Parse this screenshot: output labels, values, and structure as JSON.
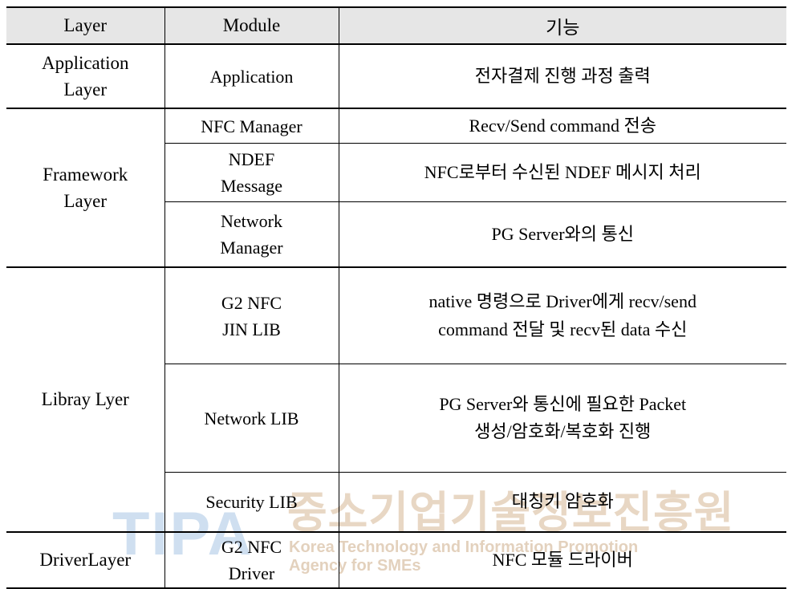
{
  "document": {
    "type": "spec-table",
    "title_visible": false
  },
  "watermark": {
    "logo_text": "TIPA",
    "korean_name": "중소기업기술정보진흥원",
    "english_line1": "Korea Technology and Information Promotion",
    "english_line2": "Agency for SMEs",
    "logo_color": "#cfdff0",
    "korean_color": "#e8d7c4",
    "english_color": "#e3d1bd"
  },
  "table": {
    "header_background": "#e6e6e6",
    "border_color": "#000000",
    "columns": [
      {
        "key": "layer",
        "label": "Layer"
      },
      {
        "key": "module",
        "label": "Module"
      },
      {
        "key": "func",
        "label": "기능"
      }
    ],
    "groups": [
      {
        "layer_lines": [
          "Application",
          "Layer"
        ],
        "rows": [
          {
            "module_lines": [
              "Application"
            ],
            "func_lines": [
              "전자결제 진행 과정 출력"
            ]
          }
        ]
      },
      {
        "layer_lines": [
          "Framework",
          "Layer"
        ],
        "rows": [
          {
            "module_lines": [
              "NFC Manager"
            ],
            "func_lines": [
              "Recv/Send command 전송"
            ]
          },
          {
            "module_lines": [
              "NDEF",
              "Message"
            ],
            "func_lines": [
              "NFC로부터 수신된 NDEF 메시지 처리"
            ]
          },
          {
            "module_lines": [
              "Network",
              "Manager"
            ],
            "func_lines": [
              "PG Server와의 통신"
            ]
          }
        ]
      },
      {
        "layer_lines": [
          "Libray Lyer"
        ],
        "rows": [
          {
            "module_lines": [
              "G2 NFC",
              "JIN LIB"
            ],
            "func_lines": [
              "native 명령으로 Driver에게 recv/send",
              "command 전달 및 recv된 data 수신"
            ]
          },
          {
            "module_lines": [
              "Network LIB"
            ],
            "func_lines": [
              "PG Server와 통신에 필요한 Packet",
              "생성/암호화/복호화 진행"
            ]
          },
          {
            "module_lines": [
              "Security LIB"
            ],
            "func_lines": [
              "대칭키 암호화"
            ]
          }
        ]
      },
      {
        "layer_lines": [
          "DriverLayer"
        ],
        "rows": [
          {
            "module_lines": [
              "G2 NFC",
              "Driver"
            ],
            "func_lines": [
              "NFC 모듈 드라이버"
            ]
          }
        ]
      }
    ]
  }
}
